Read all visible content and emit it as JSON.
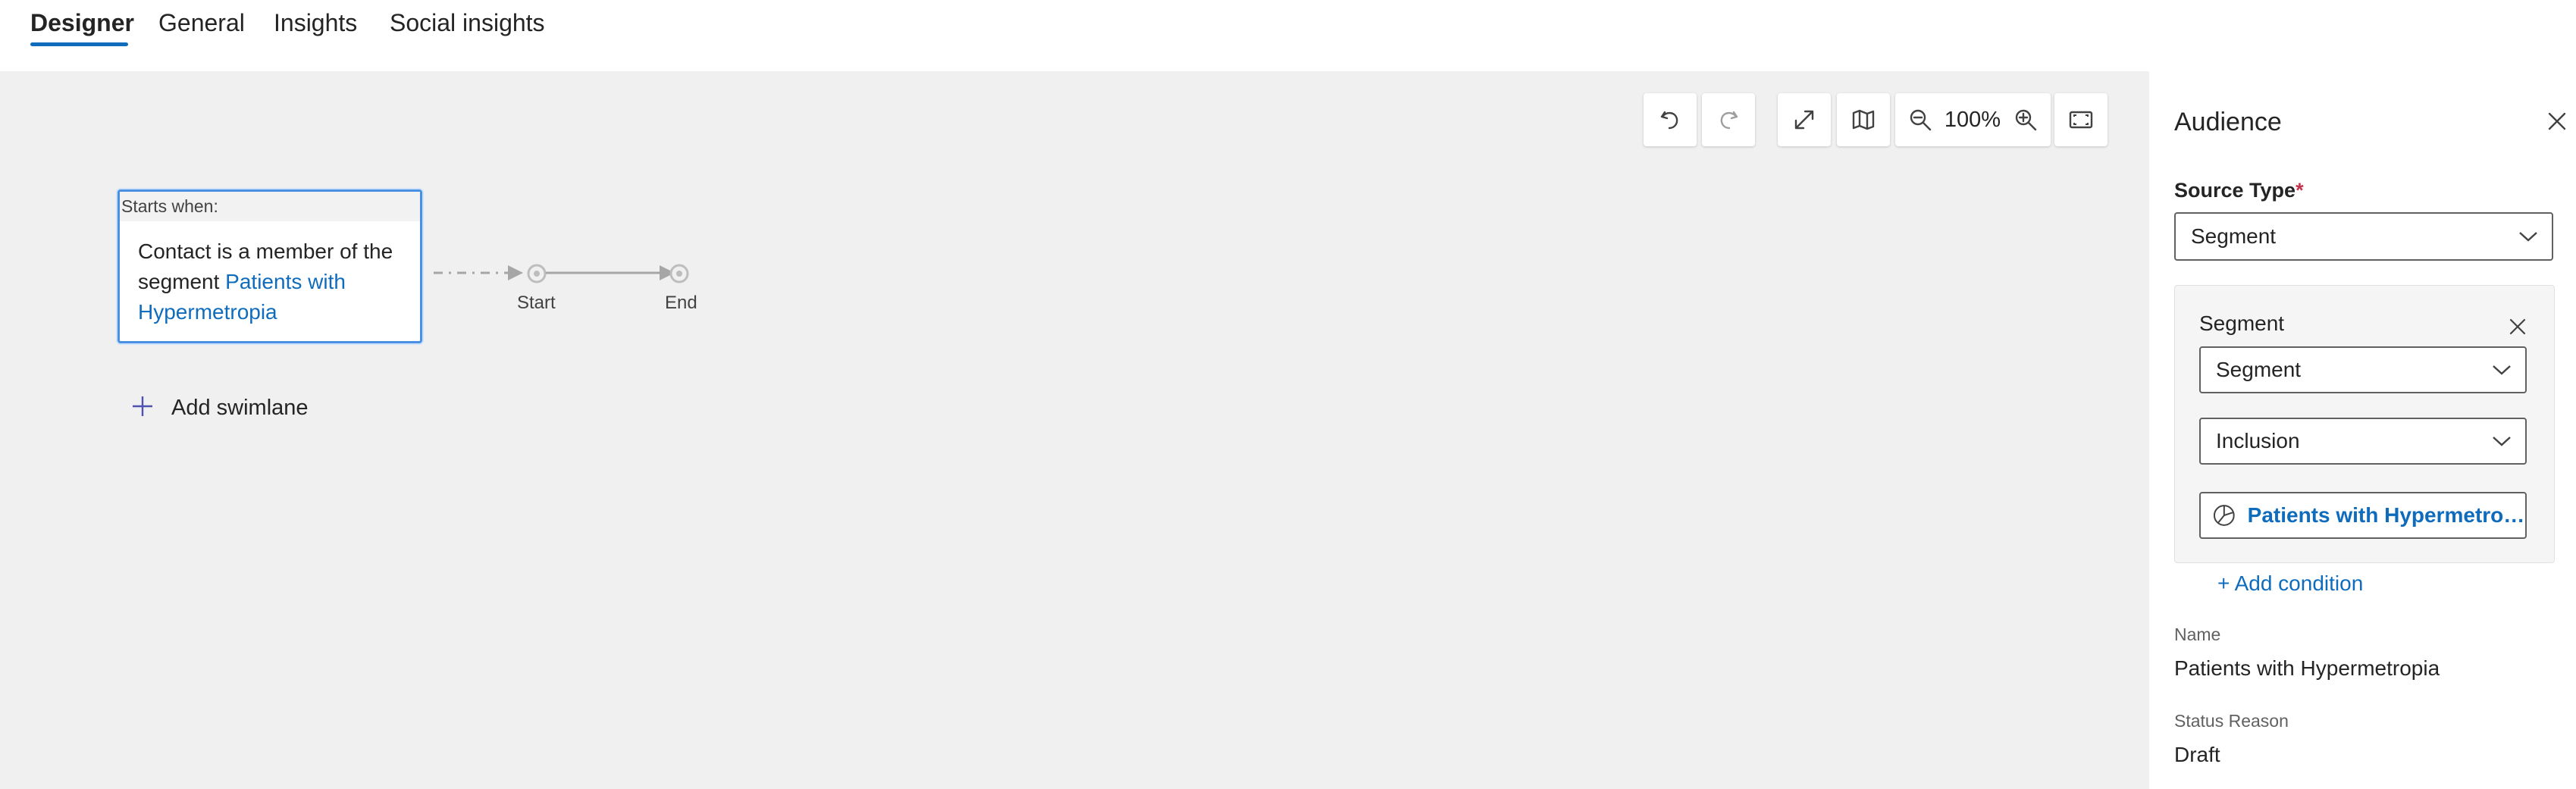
{
  "tabs": [
    {
      "label": "Designer",
      "active": true
    },
    {
      "label": "General",
      "active": false
    },
    {
      "label": "Insights",
      "active": false
    },
    {
      "label": "Social insights",
      "active": false
    }
  ],
  "toolbar": {
    "zoom_level": "100%",
    "icons": [
      "undo-icon",
      "redo-icon",
      "expand-icon",
      "map-icon",
      "zoom-out-icon",
      "zoom-in-icon",
      "fit-to-screen-icon"
    ]
  },
  "canvas": {
    "trigger": {
      "header": "Starts when:",
      "text_before": "Contact is a member of the segment ",
      "link_text": "Patients with Hypermetropia"
    },
    "nodes": {
      "start": "Start",
      "end": "End"
    },
    "add_swimlane": "Add swimlane"
  },
  "panel": {
    "title": "Audience",
    "source_type_label": "Source Type",
    "required_marker": "*",
    "source_type_value": "Segment",
    "segment_section": {
      "title": "Segment",
      "segment_dropdown": "Segment",
      "inclusion_dropdown": "Inclusion",
      "selected_segment": "Patients with Hypermetropia"
    },
    "add_condition": "+ Add condition",
    "name_label": "Name",
    "name_value": "Patients with Hypermetropia",
    "status_label": "Status Reason",
    "status_value": "Draft"
  },
  "colors": {
    "accent": "#0f6cbd",
    "canvas_bg": "#f0f0f0",
    "trigger_border": "#4a90e2",
    "required": "#c4314b"
  }
}
